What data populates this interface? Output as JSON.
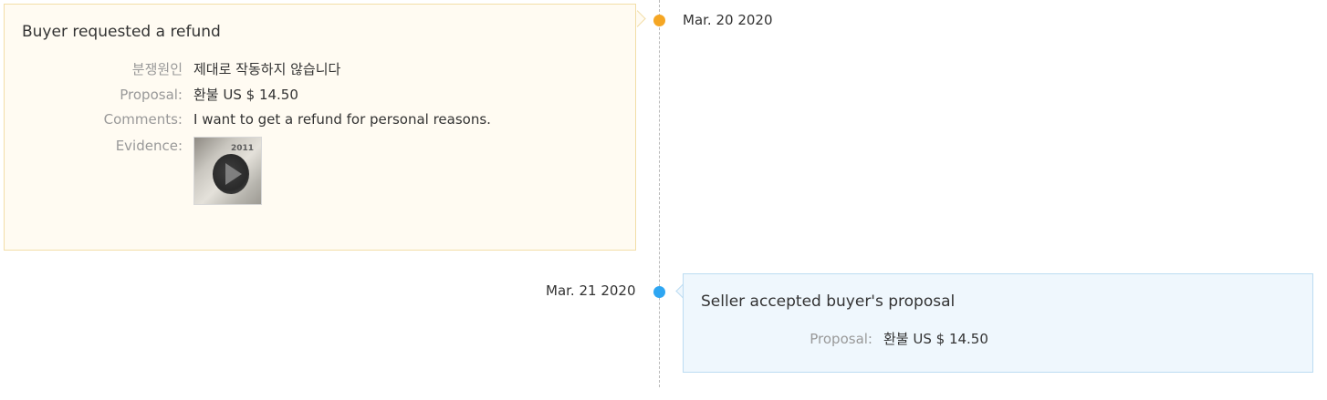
{
  "colors": {
    "orange_dot": "#f5a623",
    "blue_dot": "#2ea6f2",
    "refund_bg": "#fffbf2",
    "accept_bg": "#eff7fd"
  },
  "timeline": {
    "event1": {
      "date": "Mar. 20 2020",
      "title": "Buyer requested a refund",
      "rows": [
        {
          "label": "분쟁원인",
          "value": "제대로 작동하지 않습니다"
        },
        {
          "label": "Proposal:",
          "value": "환불 US $ 14.50"
        },
        {
          "label": "Comments:",
          "value": "I want to get a refund for personal reasons."
        },
        {
          "label": "Evidence:",
          "value": ""
        }
      ],
      "evidence_icon": "play-icon",
      "evidence_image_text": "2011"
    },
    "event2": {
      "date": "Mar. 21 2020",
      "title": "Seller accepted buyer's proposal",
      "rows": [
        {
          "label": "Proposal:",
          "value": "환불 US $ 14.50"
        }
      ]
    }
  }
}
